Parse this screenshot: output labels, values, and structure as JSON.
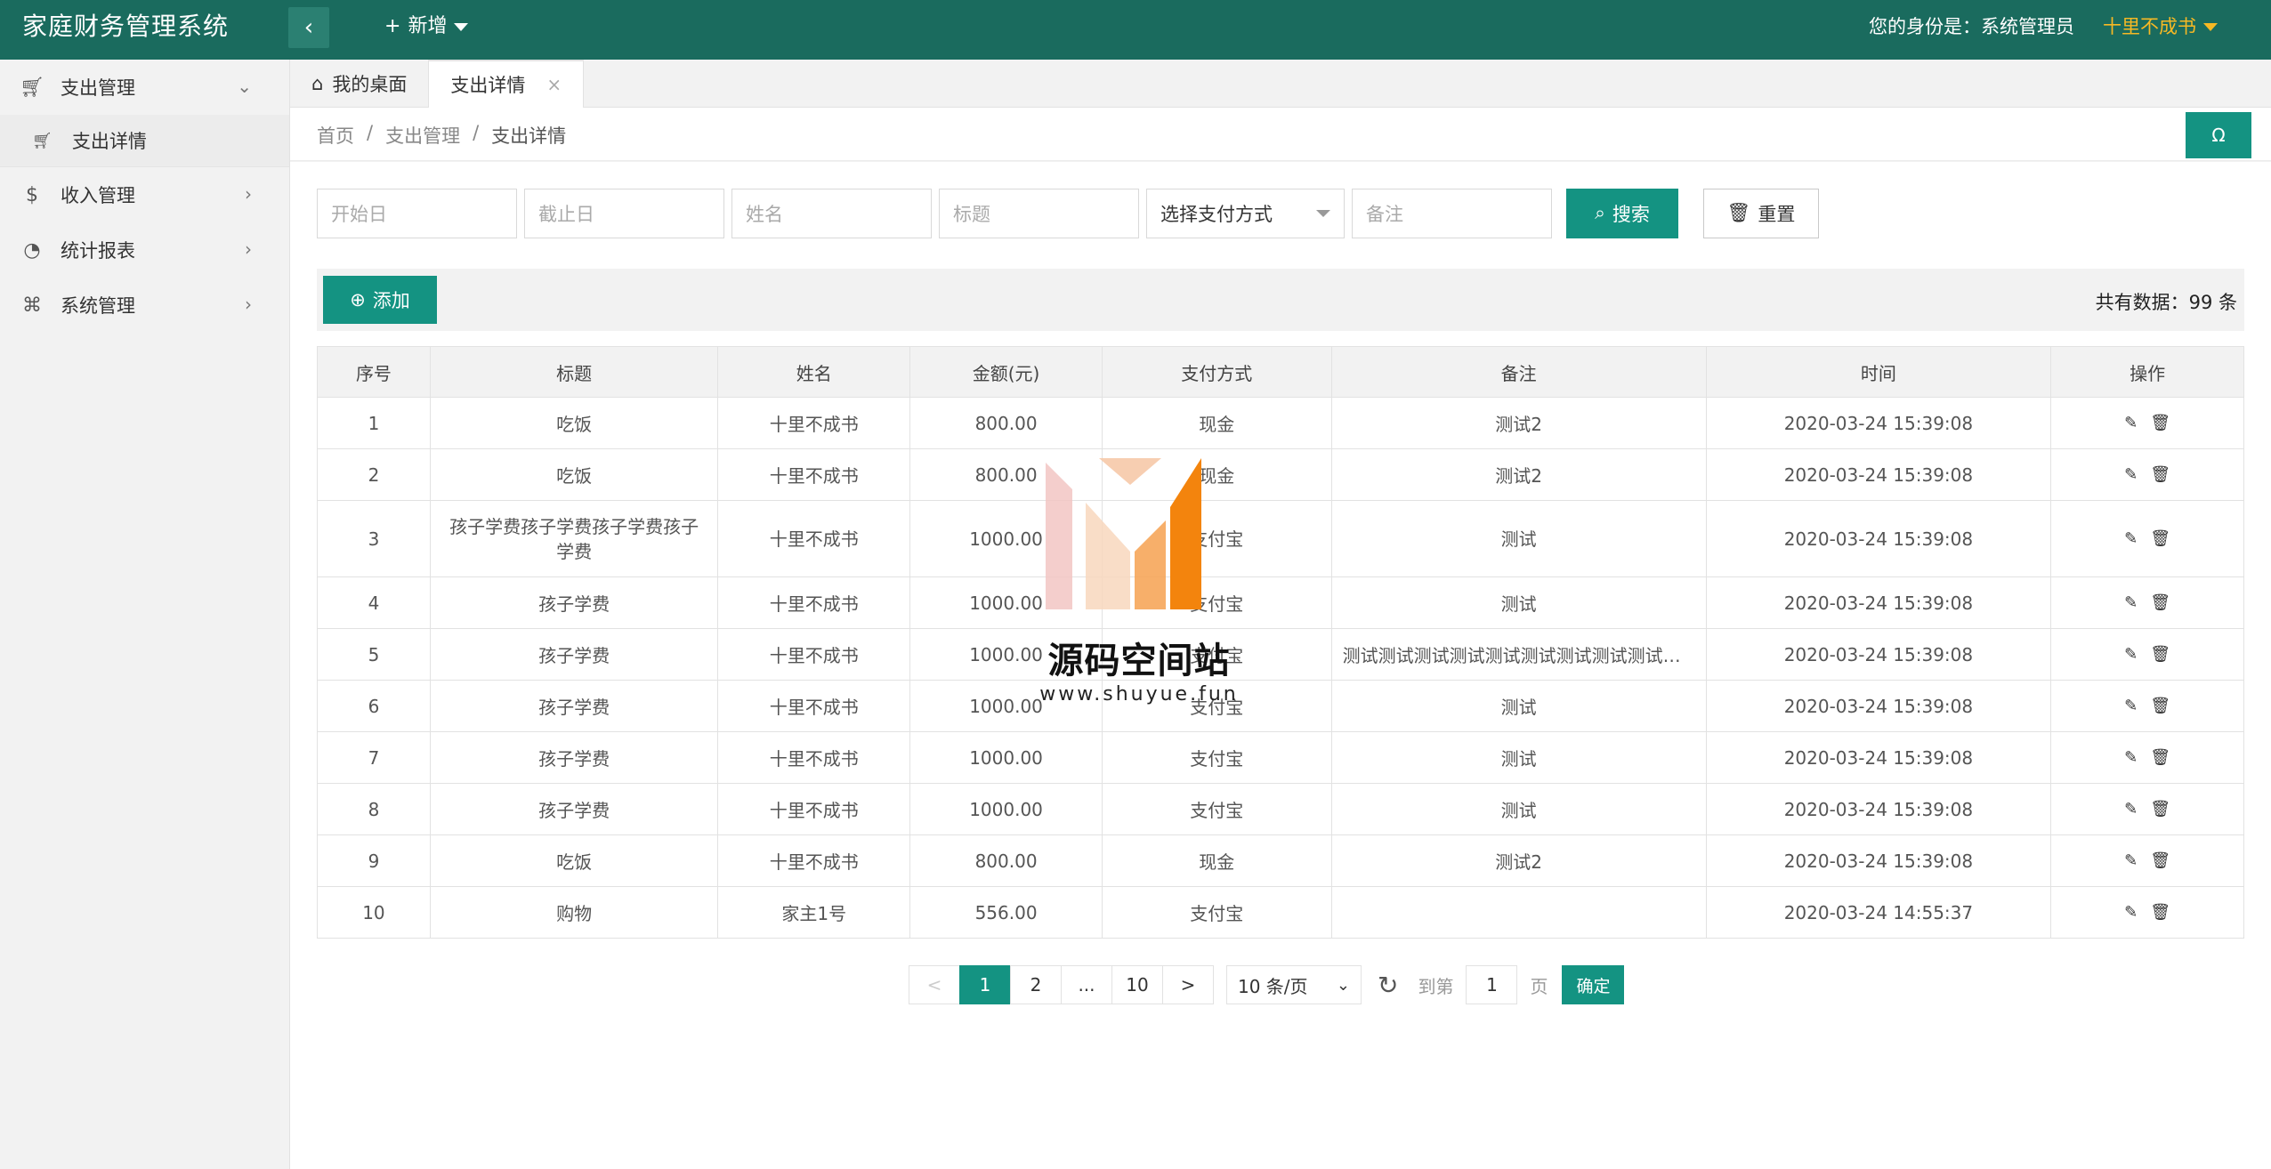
{
  "header": {
    "title": "家庭财务管理系统",
    "new_label": "新增",
    "identity_label": "您的身份是：系统管理员",
    "user_name": "十里不成书"
  },
  "sidebar": {
    "items": [
      {
        "label": "支出管理",
        "icon": "cart-icon",
        "expanded": true,
        "children": [
          {
            "label": "支出详情",
            "icon": "cart-icon"
          }
        ]
      },
      {
        "label": "收入管理",
        "icon": "dollar-icon"
      },
      {
        "label": "统计报表",
        "icon": "chart-line-icon"
      },
      {
        "label": "系统管理",
        "icon": "grid-icon"
      }
    ]
  },
  "tabs": [
    {
      "label": "我的桌面",
      "icon": "home-icon"
    },
    {
      "label": "支出详情",
      "active": true
    }
  ],
  "breadcrumb": [
    "首页",
    "支出管理",
    "支出详情"
  ],
  "refresh_icon": "Ω",
  "filters": {
    "start_placeholder": "开始日",
    "end_placeholder": "截止日",
    "name_placeholder": "姓名",
    "title_placeholder": "标题",
    "payment_select": "选择支付方式",
    "remark_placeholder": "备注",
    "search_label": "搜索",
    "reset_label": "重置"
  },
  "toolbar": {
    "add_label": "添加",
    "total_label": "共有数据：99 条"
  },
  "table": {
    "headers": [
      "序号",
      "标题",
      "姓名",
      "金额(元)",
      "支付方式",
      "备注",
      "时间",
      "操作"
    ],
    "rows": [
      [
        "1",
        "吃饭",
        "十里不成书",
        "800.00",
        "现金",
        "测试2",
        "2020-03-24 15:39:08"
      ],
      [
        "2",
        "吃饭",
        "十里不成书",
        "800.00",
        "现金",
        "测试2",
        "2020-03-24 15:39:08"
      ],
      [
        "3",
        "孩子学费孩子学费孩子学费孩子学费",
        "十里不成书",
        "1000.00",
        "支付宝",
        "测试",
        "2020-03-24 15:39:08"
      ],
      [
        "4",
        "孩子学费",
        "十里不成书",
        "1000.00",
        "支付宝",
        "测试",
        "2020-03-24 15:39:08"
      ],
      [
        "5",
        "孩子学费",
        "十里不成书",
        "1000.00",
        "支付宝",
        "测试测试测试测试测试测试测试测试测试测试",
        "2020-03-24 15:39:08"
      ],
      [
        "6",
        "孩子学费",
        "十里不成书",
        "1000.00",
        "支付宝",
        "测试",
        "2020-03-24 15:39:08"
      ],
      [
        "7",
        "孩子学费",
        "十里不成书",
        "1000.00",
        "支付宝",
        "测试",
        "2020-03-24 15:39:08"
      ],
      [
        "8",
        "孩子学费",
        "十里不成书",
        "1000.00",
        "支付宝",
        "测试",
        "2020-03-24 15:39:08"
      ],
      [
        "9",
        "吃饭",
        "十里不成书",
        "800.00",
        "现金",
        "测试2",
        "2020-03-24 15:39:08"
      ],
      [
        "10",
        "购物",
        "家主1号",
        "556.00",
        "支付宝",
        "",
        "2020-03-24 14:55:37"
      ]
    ]
  },
  "pager": {
    "prev": "<",
    "pages": [
      "1",
      "2",
      "...",
      "10"
    ],
    "next": ">",
    "current": "1",
    "page_size": "10 条/页",
    "goto_label": "到第",
    "goto_value": "1",
    "page_unit": "页",
    "confirm_label": "确定"
  },
  "watermark": {
    "text": "源码空间站",
    "url": "www.shuyue.fun"
  },
  "colors": {
    "header": "#1a6b5e",
    "accent": "#149382",
    "user": "#f7b924"
  }
}
